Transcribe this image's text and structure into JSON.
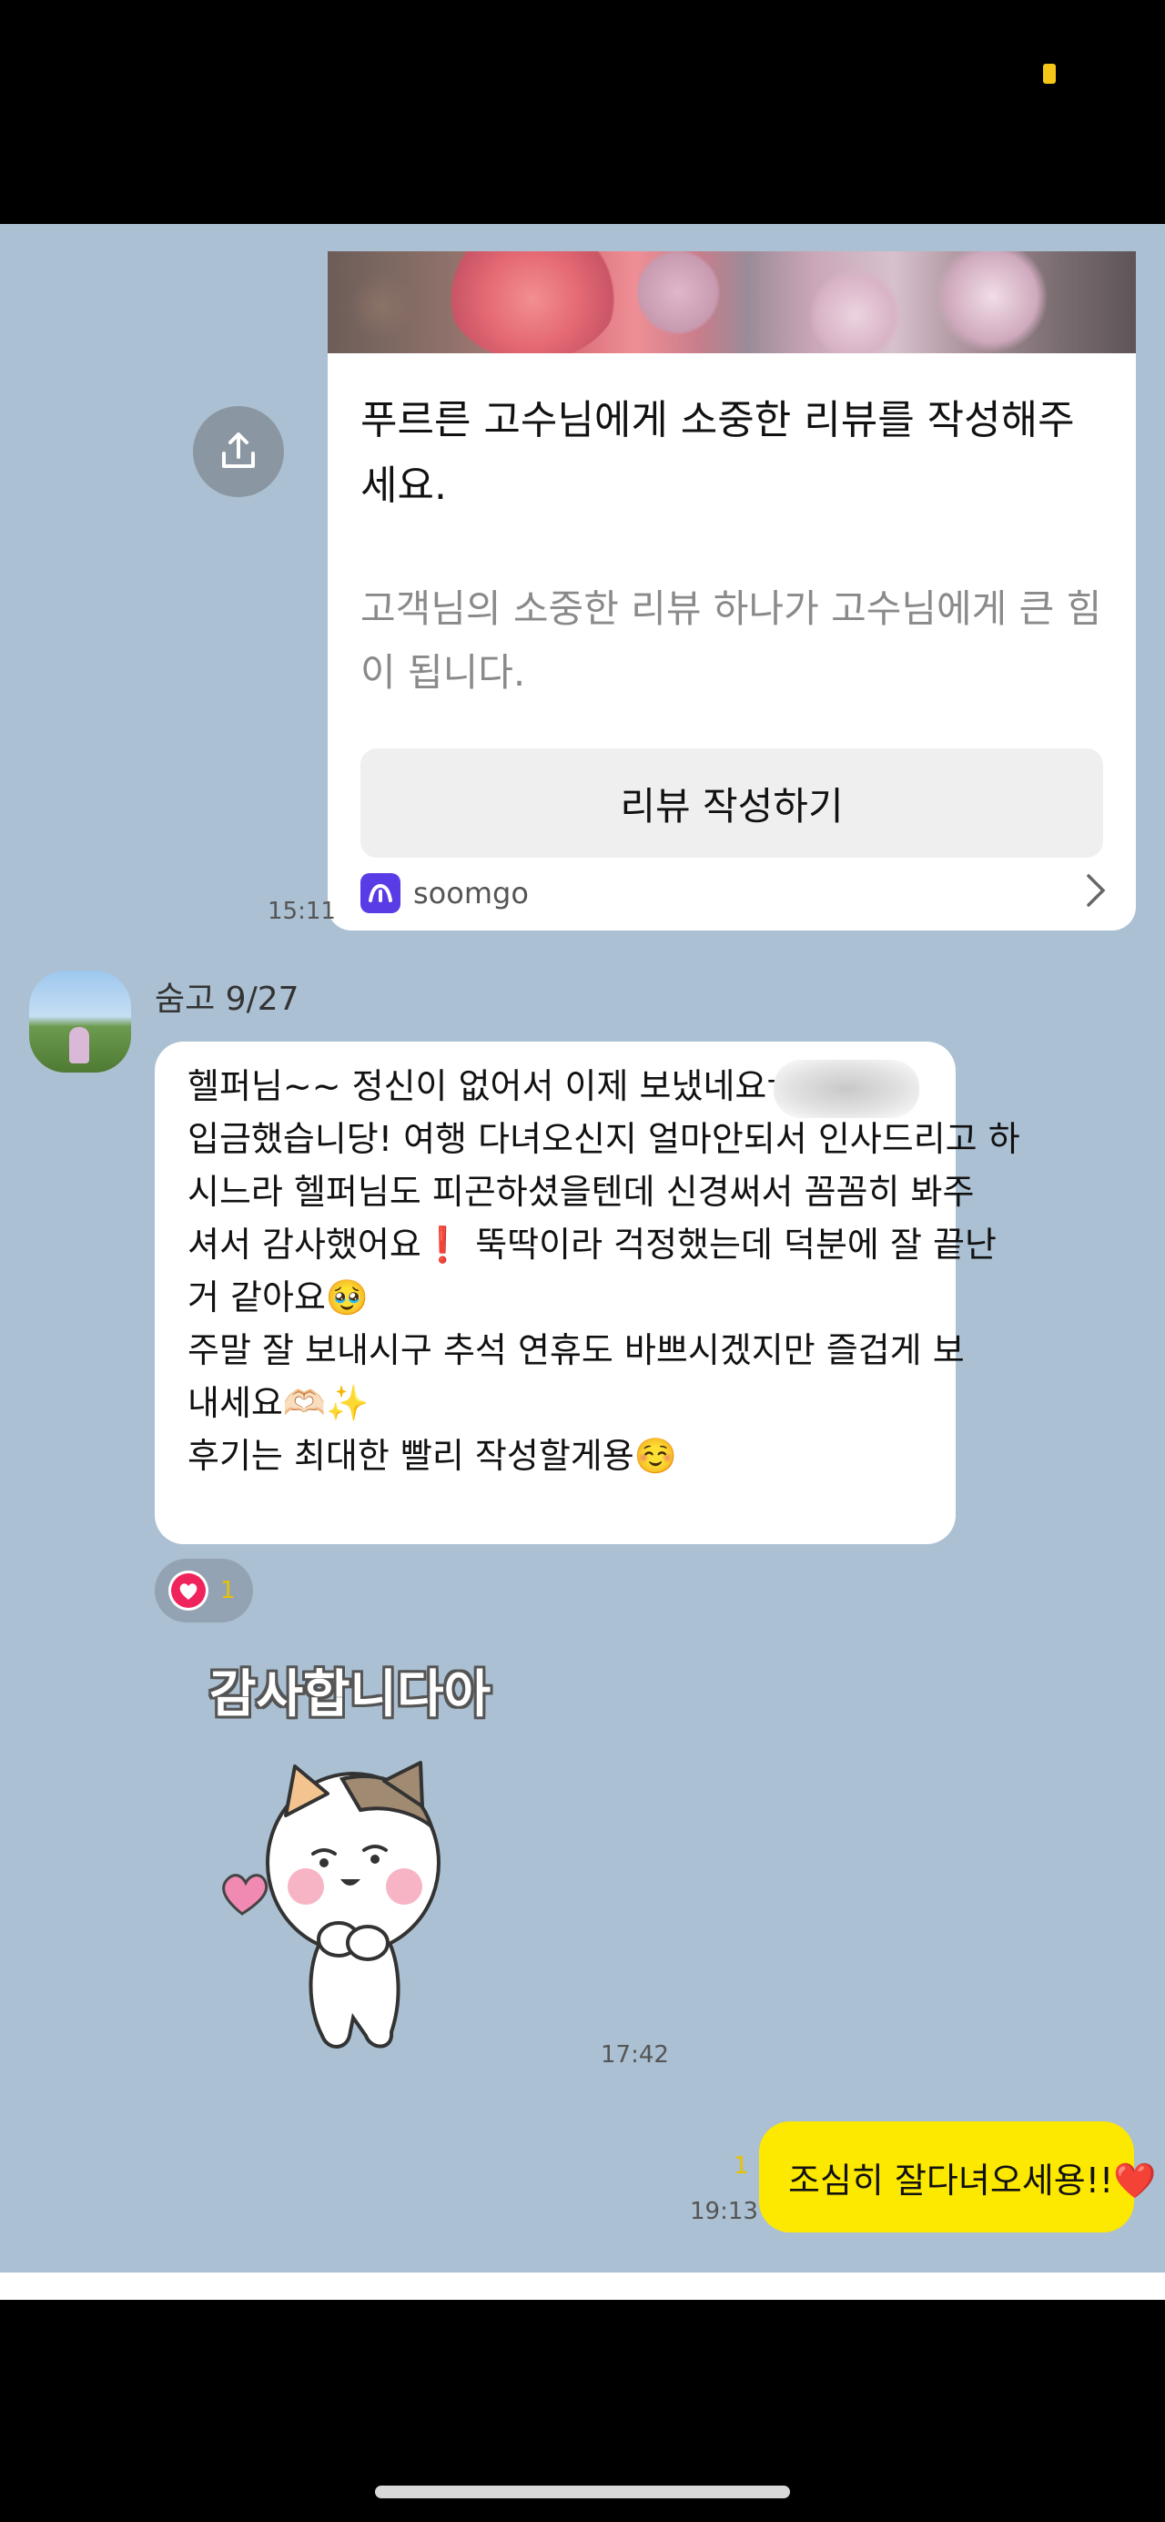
{
  "review_card": {
    "title": "푸르른 고수님에게 소중한 리뷰를 작성해주세요.",
    "description": "고객님의 소중한 리뷰 하나가 고수님에게 큰 힘이 됩니다.",
    "button_label": "리뷰 작성하기",
    "brand": "soomgo",
    "brand_color": "#5a3ce6",
    "time": "15:11",
    "icons": [
      "share-icon",
      "soomgo-logo-icon",
      "chevron-right-icon"
    ]
  },
  "incoming": {
    "sender": "숨고 9/27",
    "lines": [
      "헬퍼님~~ 정신이 없어서 이제 보냈네요ㅠㅠ",
      "입금했습니당! 여행 다녀오신지 얼마안되서 인사드리고 하",
      "시느라 헬퍼님도 피곤하셨을텐데 신경써서 꼼꼼히 봐주",
      "셔서 감사했어요❗ 뚝딱이라 걱정했는데 덕분에 잘 끝난",
      "거 같아요🥹",
      "주말 잘 보내시구 추석 연휴도 바쁘시겠지만 즐겁게 보",
      "내세요🫶🏻✨",
      "후기는 최대한 빨리 작성할게용☺️"
    ],
    "reaction_count": "1",
    "reaction_icon": "heart-icon"
  },
  "sticker": {
    "caption": "감사합니다아",
    "time": "17:42"
  },
  "outgoing": {
    "unread": "1",
    "text": "조심히 잘다녀오세용!!❤️",
    "time": "19:13",
    "bubble_color": "#fde800"
  }
}
